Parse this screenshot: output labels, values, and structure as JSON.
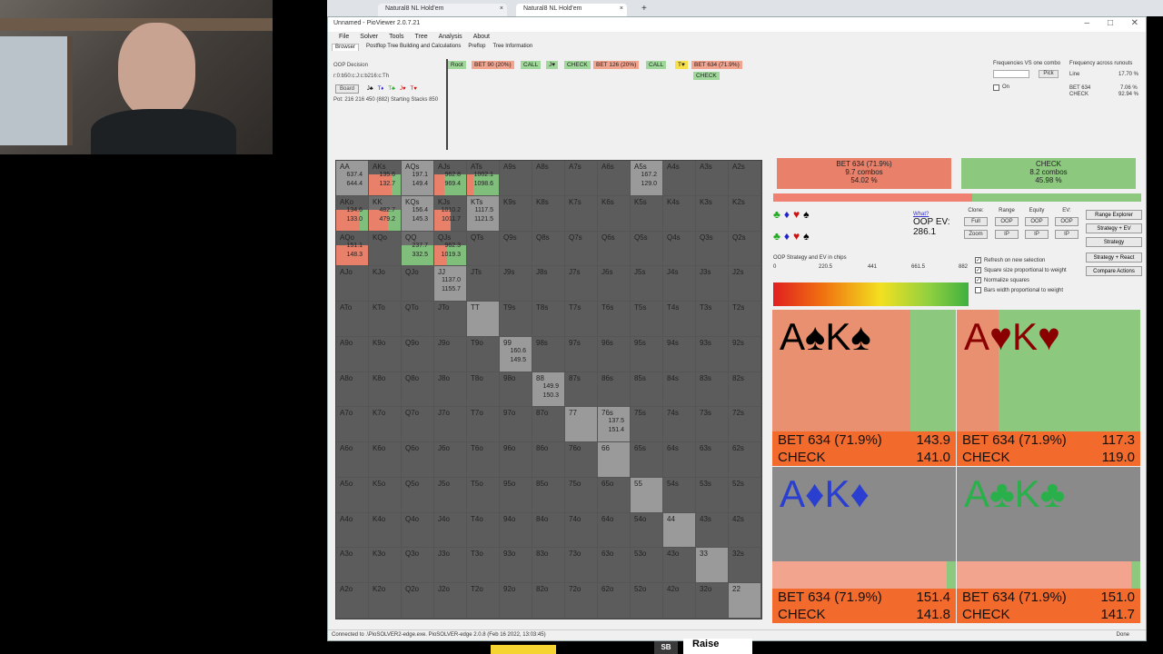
{
  "browser": {
    "tabs": [
      {
        "label": "Natural8 NL Hold'em",
        "close": "×"
      },
      {
        "label": "Natural8 NL Hold'em",
        "close": "×"
      }
    ],
    "new_tab": "+"
  },
  "window": {
    "title": "Unnamed - PioViewer 2.0.7.21",
    "minimize": "–",
    "maximize": "□",
    "close": "✕"
  },
  "menu": [
    "File",
    "Solver",
    "Tools",
    "Tree",
    "Analysis",
    "About"
  ],
  "subtabs": [
    "Browser",
    "Postflop Tree Building and Calculations",
    "Preflop",
    "Tree Information"
  ],
  "top_left": {
    "decision": "OOP Decision",
    "board_line": "r:0:b50:c:J:c:b216:c:Th",
    "board_button": "Board",
    "board_cards": [
      {
        "rank": "J",
        "suit": "♣",
        "color": "#000"
      },
      {
        "rank": "T",
        "suit": "♦",
        "color": "#22c"
      },
      {
        "rank": "T",
        "suit": "♣",
        "color": "#2a2"
      },
      {
        "rank": "J",
        "suit": "♥",
        "color": "#c11"
      },
      {
        "rank": "T",
        "suit": "♥",
        "color": "#c11"
      }
    ],
    "pot": "Pot: 216 216 450 (882) Starting Stacks 850"
  },
  "tree_nodes": [
    {
      "label": "Root",
      "bg": "#9fd89a"
    },
    {
      "label": "BET 90 (20%)",
      "bg": "#f3a48f"
    },
    {
      "label": "CALL",
      "bg": "#9fd89a"
    },
    {
      "label": "J♥",
      "bg": "#9fd89a"
    },
    {
      "label": "CHECK",
      "bg": "#9fd89a"
    },
    {
      "label": "BET 126 (20%)",
      "bg": "#f3a48f"
    },
    {
      "label": "CALL",
      "bg": "#9fd89a"
    },
    {
      "label": "T♥",
      "bg": "#f7e04a"
    },
    {
      "label": "BET 634 (71.9%)",
      "bg": "#f3a48f"
    },
    {
      "label": "CHECK",
      "bg": "#9fd89a"
    }
  ],
  "top_right": {
    "freq_label": "Frequencies VS one combo",
    "pick_btn": "Pick",
    "on_label": "On",
    "runouts_label": "Frequency across runouts",
    "line_label": "Line",
    "line_val": "17.70 %",
    "bet_label": "BET 634",
    "bet_val": "7.06 %",
    "check_label": "CHECK",
    "check_val": "92.94 %"
  },
  "grid": {
    "rows": [
      [
        "AA",
        "AKs",
        "AQs",
        "AJs",
        "ATs",
        "A9s",
        "A8s",
        "A7s",
        "A6s",
        "A5s",
        "A4s",
        "A3s",
        "A2s"
      ],
      [
        "AKo",
        "KK",
        "KQs",
        "KJs",
        "KTs",
        "K9s",
        "K8s",
        "K7s",
        "K6s",
        "K5s",
        "K4s",
        "K3s",
        "K2s"
      ],
      [
        "AQo",
        "KQo",
        "QQ",
        "QJs",
        "QTs",
        "Q9s",
        "Q8s",
        "Q7s",
        "Q6s",
        "Q5s",
        "Q4s",
        "Q3s",
        "Q2s"
      ],
      [
        "AJo",
        "KJo",
        "QJo",
        "JJ",
        "JTs",
        "J9s",
        "J8s",
        "J7s",
        "J6s",
        "J5s",
        "J4s",
        "J3s",
        "J2s"
      ],
      [
        "ATo",
        "KTo",
        "QTo",
        "JTo",
        "TT",
        "T9s",
        "T8s",
        "T7s",
        "T6s",
        "T5s",
        "T4s",
        "T3s",
        "T2s"
      ],
      [
        "A9o",
        "K9o",
        "Q9o",
        "J9o",
        "T9o",
        "99",
        "98s",
        "97s",
        "96s",
        "95s",
        "94s",
        "93s",
        "92s"
      ],
      [
        "A8o",
        "K8o",
        "Q8o",
        "J8o",
        "T8o",
        "98o",
        "88",
        "87s",
        "86s",
        "85s",
        "84s",
        "83s",
        "82s"
      ],
      [
        "A7o",
        "K7o",
        "Q7o",
        "J7o",
        "T7o",
        "97o",
        "87o",
        "77",
        "76s",
        "75s",
        "74s",
        "73s",
        "72s"
      ],
      [
        "A6o",
        "K6o",
        "Q6o",
        "J6o",
        "T6o",
        "96o",
        "86o",
        "76o",
        "66",
        "65s",
        "64s",
        "63s",
        "62s"
      ],
      [
        "A5o",
        "K5o",
        "Q5o",
        "J5o",
        "T5o",
        "95o",
        "85o",
        "75o",
        "65o",
        "55",
        "54s",
        "53s",
        "52s"
      ],
      [
        "A4o",
        "K4o",
        "Q4o",
        "J4o",
        "T4o",
        "94o",
        "84o",
        "74o",
        "64o",
        "54o",
        "44",
        "43s",
        "42s"
      ],
      [
        "A3o",
        "K3o",
        "Q3o",
        "J3o",
        "T3o",
        "93o",
        "83o",
        "73o",
        "63o",
        "53o",
        "43o",
        "33",
        "32s"
      ],
      [
        "A2o",
        "K2o",
        "Q2o",
        "J2o",
        "T2o",
        "92o",
        "82o",
        "72o",
        "62o",
        "52o",
        "42o",
        "32o",
        "22"
      ]
    ],
    "details": {
      "0-0": {
        "lines": [
          "637.4",
          "644.4"
        ],
        "red": 0.0,
        "green": 0.0
      },
      "0-1": {
        "lines": [
          "135.6",
          "132.7"
        ],
        "red": 0.7,
        "green": 0.3
      },
      "0-2": {
        "lines": [
          "197.1",
          "149.4"
        ],
        "red": 0.0,
        "green": 0.0
      },
      "0-3": {
        "lines": [
          "962.8",
          "969.4"
        ],
        "red": 0.3,
        "green": 0.7
      },
      "0-4": {
        "lines": [
          "1002.1",
          "1098.6"
        ],
        "red": 0.2,
        "green": 0.8
      },
      "0-9": {
        "lines": [
          "167.2",
          "129.0"
        ],
        "red": 0.0,
        "green": 0.0
      },
      "1-0": {
        "lines": [
          "134.6",
          "133.0"
        ],
        "red": 0.75,
        "green": 0.25
      },
      "1-1": {
        "lines": [
          "482.7",
          "479.2"
        ],
        "red": 0.6,
        "green": 0.4
      },
      "1-2": {
        "lines": [
          "156.4",
          "145.3"
        ],
        "red": 0.0,
        "green": 0.0
      },
      "1-3": {
        "lines": [
          "1010.2",
          "1011.7"
        ],
        "red": 0.5,
        "green": 0.0
      },
      "1-4": {
        "lines": [
          "1117.5",
          "1121.5"
        ],
        "red": 0.0,
        "green": 0.0
      },
      "2-0": {
        "lines": [
          "151.1",
          "148.3"
        ],
        "red": 1.0,
        "green": 0.0
      },
      "2-2": {
        "lines": [
          "237.7",
          "332.5"
        ],
        "red": 0.0,
        "green": 1.0
      },
      "2-3": {
        "lines": [
          "962.3",
          "1019.3"
        ],
        "red": 0.4,
        "green": 0.6
      },
      "3-3": {
        "lines": [
          "1137.0",
          "1155.7"
        ],
        "red": 0.0,
        "green": 0.0
      },
      "5-5": {
        "lines": [
          "160.6",
          "149.5"
        ],
        "red": 0.0,
        "green": 0.0
      },
      "6-6": {
        "lines": [
          "149.9",
          "150.3"
        ],
        "red": 0.0,
        "green": 0.0
      },
      "7-8": {
        "lines": [
          "137.5",
          "151.4"
        ],
        "red": 0.0,
        "green": 0.0
      }
    }
  },
  "strategy": {
    "bet": {
      "label": "BET 634 (71.9%)",
      "combos": "9.7 combos",
      "pct": "54.02 %",
      "fraction": 0.5402
    },
    "check": {
      "label": "CHECK",
      "combos": "8.2 combos",
      "pct": "45.98 %",
      "fraction": 0.4598
    }
  },
  "ev": {
    "what": "What?",
    "label": "OOP EV:",
    "value": "286.1"
  },
  "options": {
    "clone": {
      "header": "Clone:",
      "b1": "Full",
      "b2": "Zoom"
    },
    "range": {
      "header": "Range",
      "b1": "OOP",
      "b2": "IP"
    },
    "equity": {
      "header": "Equity",
      "b1": "OOP",
      "b2": "IP"
    },
    "ev": {
      "header": "EV:",
      "b1": "OOP",
      "b2": "IP"
    }
  },
  "right_buttons": [
    "Range Explorer",
    "Strategy + EV",
    "Strategy",
    "Strategy + React",
    "Compare Actions"
  ],
  "legend": {
    "title": "OOP Strategy and EV in chips",
    "ticks": [
      "0",
      "220.5",
      "441",
      "661.5",
      "882"
    ]
  },
  "checkboxes": [
    {
      "label": "Refresh on new selection",
      "checked": true
    },
    {
      "label": "Square size proportional to weight",
      "checked": true
    },
    {
      "label": "Normalize squares",
      "checked": true
    },
    {
      "label": "Bars width proportional to weight",
      "checked": false
    }
  ],
  "combos": [
    {
      "ranks": [
        "A",
        "K"
      ],
      "suit": "♠",
      "color": "#000",
      "bet_label": "BET 634 (71.9%)",
      "bet_ev": "143.9",
      "check_label": "CHECK",
      "check_ev": "141.0",
      "bet_fraction": 0.75
    },
    {
      "ranks": [
        "A",
        "K"
      ],
      "suit": "♥",
      "color": "#8a0000",
      "bet_label": "BET 634 (71.9%)",
      "bet_ev": "117.3",
      "check_label": "CHECK",
      "check_ev": "119.0",
      "bet_fraction": 0.23
    },
    {
      "ranks": [
        "A",
        "K"
      ],
      "suit": "♦",
      "color": "#2a3fd0",
      "bet_label": "BET 634 (71.9%)",
      "bet_ev": "151.4",
      "check_label": "CHECK",
      "check_ev": "141.8",
      "bet_fraction": 0.95
    },
    {
      "ranks": [
        "A",
        "K"
      ],
      "suit": "♣",
      "color": "#2ab04a",
      "bet_label": "BET 634 (71.9%)",
      "bet_ev": "151.0",
      "check_label": "CHECK",
      "check_ev": "141.7",
      "bet_fraction": 0.95
    }
  ],
  "status": {
    "text": "Connected to .\\PioSOLVER2-edge.exe. PioSOLVER-edge 2.0.8 (Feb 16 2022, 13:03:45)",
    "done": "Done"
  },
  "overlay": {
    "badge": "SB",
    "action": "Raise"
  }
}
